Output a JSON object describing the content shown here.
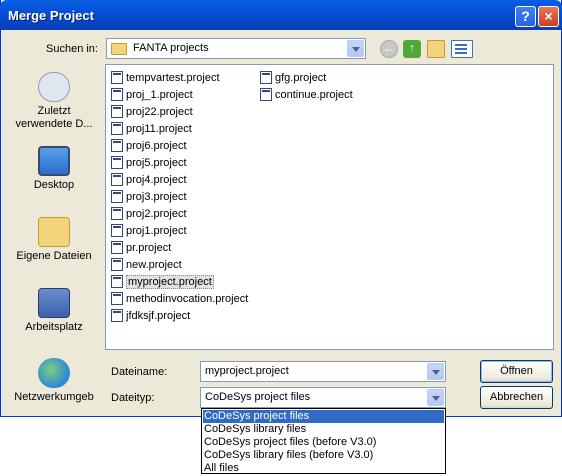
{
  "window": {
    "title": "Merge Project",
    "help_icon": "?",
    "close_icon": "×"
  },
  "toolbar": {
    "lookin_label": "Suchen in:",
    "lookin_value": "FANTA projects",
    "back_icon": "back-icon",
    "up_icon": "up-folder-icon",
    "newfolder_icon": "new-folder-icon",
    "view_icon": "view-menu-icon"
  },
  "places": [
    {
      "label": "Zuletzt verwendete D...",
      "icon": "recent-icon"
    },
    {
      "label": "Desktop",
      "icon": "desktop-icon"
    },
    {
      "label": "Eigene Dateien",
      "icon": "my-documents-icon"
    },
    {
      "label": "Arbeitsplatz",
      "icon": "my-computer-icon"
    },
    {
      "label": "Netzwerkumgeb",
      "icon": "network-icon"
    }
  ],
  "files": [
    "tempvartest.project",
    "proj_1.project",
    "proj22.project",
    "proj11.project",
    "proj6.project",
    "proj5.project",
    "proj4.project",
    "proj3.project",
    "proj2.project",
    "proj1.project",
    "pr.project",
    "new.project",
    "myproject.project",
    "methodinvocation.project",
    "jfdksjf.project",
    "gfg.project",
    "continue.project"
  ],
  "filename": {
    "label": "Dateiname:",
    "value": "myproject.project"
  },
  "filetype": {
    "label": "Dateityp:",
    "value": "CoDeSys project files"
  },
  "buttons": {
    "open": "Öffnen",
    "cancel": "Abbrechen"
  },
  "filetype_options": [
    "CoDeSys project files",
    "CoDeSys library files",
    "CoDeSys project files (before V3.0)",
    "CoDeSys library files (before V3.0)",
    "All files"
  ]
}
